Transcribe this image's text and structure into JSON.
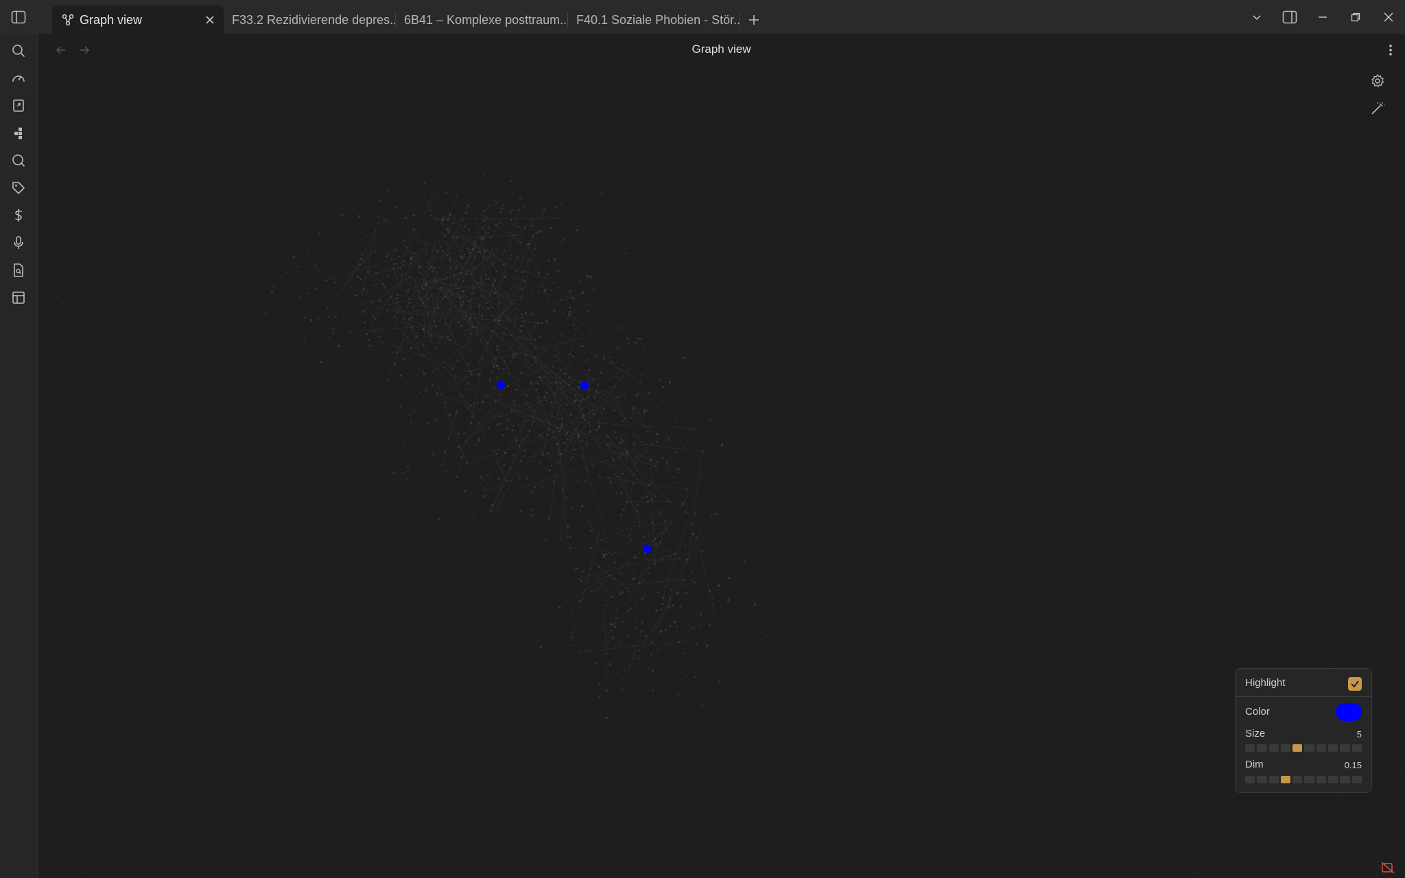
{
  "tabs": [
    {
      "label": "Graph view",
      "active": true
    },
    {
      "label": "F33.2 Rezidivierende depres..."
    },
    {
      "label": "6B41 – Komplexe posttraum..."
    },
    {
      "label": "F40.1 Soziale Phobien - Stör..."
    }
  ],
  "view": {
    "title": "Graph view"
  },
  "ribbon": [
    "search-icon",
    "dashboard-gauge-icon",
    "open-note-icon",
    "blocks-icon",
    "magnifier-icon",
    "tag-icon",
    "dollar-icon",
    "microphone-icon",
    "file-search-icon",
    "layout-icon"
  ],
  "graph": {
    "highlighted_nodes": 3,
    "highlight_color": "#0000ff"
  },
  "panel": {
    "highlight_label": "Highlight",
    "highlight_checked": true,
    "color_label": "Color",
    "color_value": "#0000ff",
    "size_label": "Size",
    "size_value": "5",
    "size_step": 5,
    "dim_label": "Dim",
    "dim_value": "0.15",
    "dim_step": 4,
    "steps_total": 10
  },
  "colors": {
    "accent": "#c9974a",
    "background": "#1e1e1e",
    "titlebar": "#2a2a2a"
  }
}
